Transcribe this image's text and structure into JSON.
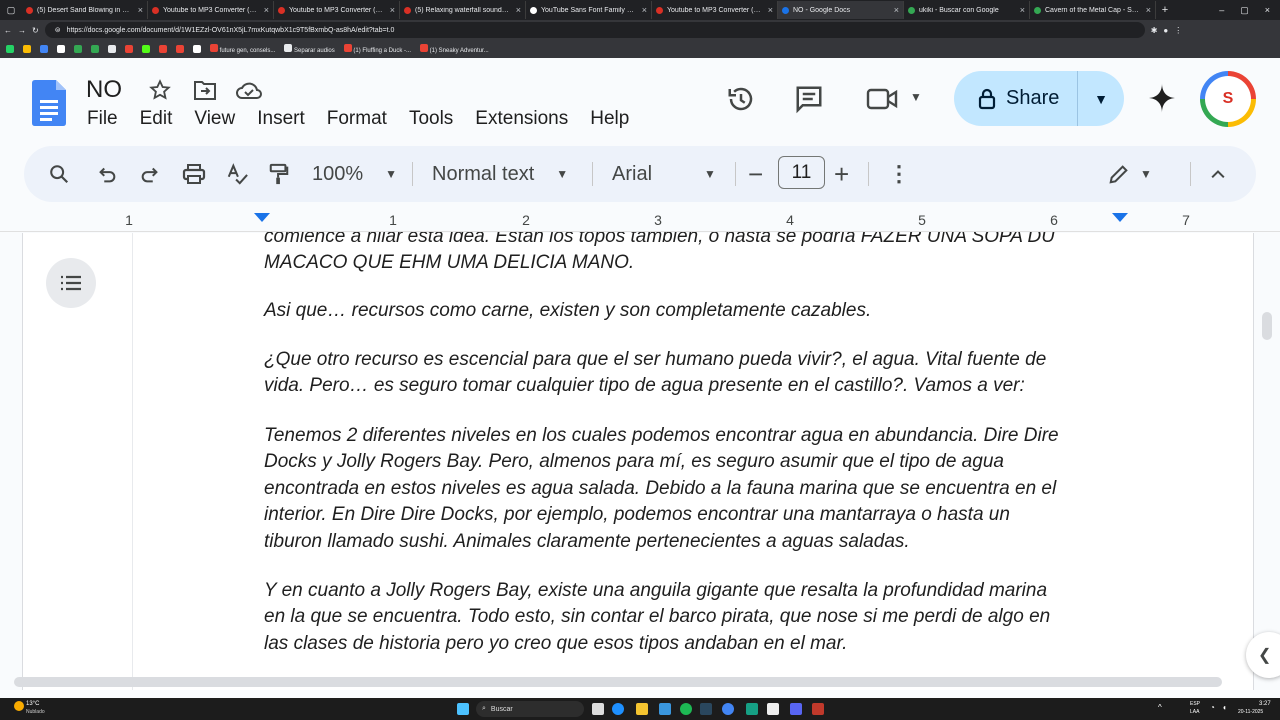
{
  "browser": {
    "tabs": [
      {
        "title": "(5) Desert Sand Blowing in Win..."
      },
      {
        "title": "Youtube to MP3 Converter (Ad-..."
      },
      {
        "title": "Youtube to MP3 Converter (Ad-..."
      },
      {
        "title": "(5) Relaxing waterfall sounds fo..."
      },
      {
        "title": "YouTube Sans Font Family Dow..."
      },
      {
        "title": "Youtube to MP3 Converter (Ad-..."
      },
      {
        "title": "NO - Google Docs"
      },
      {
        "title": "ukiki - Buscar con Google"
      },
      {
        "title": "Cavern of the Metal Cap - Supe..."
      }
    ],
    "url": "https://docs.google.com/document/d/1W1EZzl-OV61nX5jL7mxKutqwbX1c9T5fBxmbQ-as8hA/edit?tab=t.0",
    "bookmarks": [
      "future gen, consels...",
      "Separar audios",
      "(1) Fluffing a Duck -...",
      "(1) Sneaky Adventur..."
    ]
  },
  "doc": {
    "title": "NO",
    "menu": [
      "File",
      "Edit",
      "View",
      "Insert",
      "Format",
      "Tools",
      "Extensions",
      "Help"
    ],
    "share_label": "Share",
    "zoom": "100%",
    "style": "Normal text",
    "font": "Arial",
    "font_size": "11",
    "ruler": [
      "1",
      "1",
      "2",
      "3",
      "4",
      "5",
      "6",
      "7"
    ],
    "avatar_letter": "S"
  },
  "body": {
    "p0a": "comience a hilar esta idea. Están los topos también, o hasta se podría FAZER UNA SOPA DU",
    "p0b": "MACACO QUE EHM UMA DELICIA MANO.",
    "p1": "Asi que… recursos como carne, existen y son completamente cazables.",
    "p2a": "¿Que otro recurso es escencial para que el ser humano pueda vivir?, el agua. Vital fuente de",
    "p2b": "vida. Pero… es seguro tomar cualquier tipo de agua presente en el castillo?. Vamos a ver:",
    "p3a": "Tenemos 2 diferentes niveles en los cuales podemos encontrar agua en abundancia. Dire Dire",
    "p3b": "Docks y Jolly Rogers Bay. Pero, almenos para mí, es seguro asumir que el tipo de agua",
    "p3c": "encontrada en estos niveles es agua salada. Debido a la fauna marina que se encuentra en el",
    "p3d": "interior. En Dire Dire Docks, por ejemplo,  podemos encontrar una mantarraya o hasta un",
    "p3e": "tiburon llamado sushi. Animales claramente pertenecientes a aguas saladas.",
    "p4a": "Y en cuanto a Jolly Rogers Bay, existe una anguila gigante que resalta la profundidad marina",
    "p4b": "en la que se encuentra. Todo esto, sin contar el barco pirata, que nose si me perdi de algo en",
    "p4c": "las clases de historia pero yo creo que esos tipos andaban en el mar."
  },
  "taskbar": {
    "weather_temp": "13°C",
    "weather_desc": "Nublado",
    "search": "Buscar",
    "lang1": "ESP",
    "lang2": "LAA",
    "time": "3:27",
    "date": "20-11-2025"
  }
}
